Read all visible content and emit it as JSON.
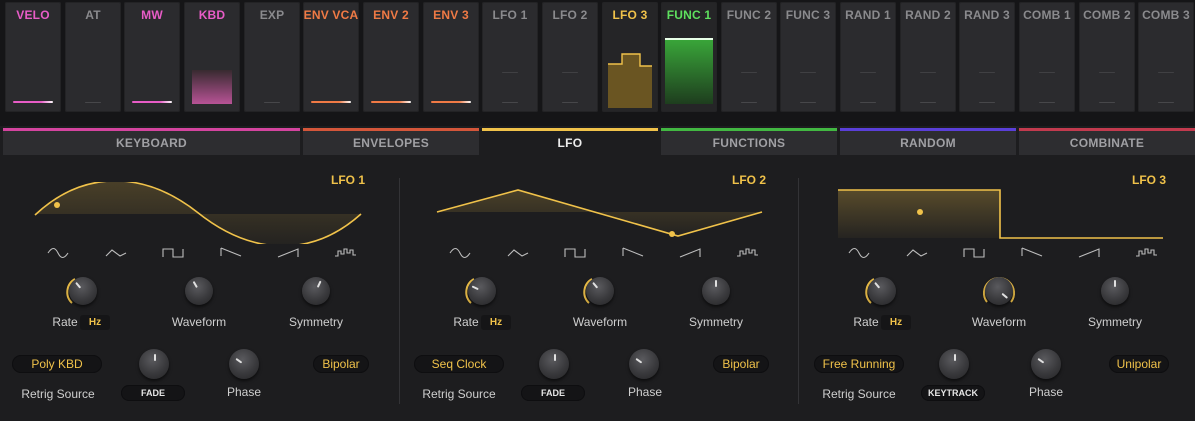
{
  "sources": [
    {
      "label": "VELO",
      "color": "#e85cc7",
      "bar": "#e85cc7"
    },
    {
      "label": "AT",
      "color": "#8a8a8d",
      "bar": ""
    },
    {
      "label": "MW",
      "color": "#e85cc7",
      "bar": "#e85cc7"
    },
    {
      "label": "KBD",
      "color": "#e85cc7",
      "bar": ""
    },
    {
      "label": "EXP",
      "color": "#8a8a8d",
      "bar": ""
    },
    {
      "label": "ENV VCA",
      "color": "#f07a45",
      "bar": "#f07a45"
    },
    {
      "label": "ENV 2",
      "color": "#f07a45",
      "bar": "#f07a45"
    },
    {
      "label": "ENV 3",
      "color": "#f07a45",
      "bar": "#f07a45"
    },
    {
      "label": "LFO 1",
      "color": "#8a8a8d",
      "bar": ""
    },
    {
      "label": "LFO 2",
      "color": "#8a8a8d",
      "bar": ""
    },
    {
      "label": "LFO 3",
      "color": "#f0c24a",
      "bar": ""
    },
    {
      "label": "FUNC 1",
      "color": "#5ee05e",
      "bar": ""
    },
    {
      "label": "FUNC 2",
      "color": "#8a8a8d",
      "bar": ""
    },
    {
      "label": "FUNC 3",
      "color": "#8a8a8d",
      "bar": ""
    },
    {
      "label": "RAND 1",
      "color": "#8a8a8d",
      "bar": ""
    },
    {
      "label": "RAND 2",
      "color": "#8a8a8d",
      "bar": ""
    },
    {
      "label": "RAND 3",
      "color": "#8a8a8d",
      "bar": ""
    },
    {
      "label": "COMB 1",
      "color": "#8a8a8d",
      "bar": ""
    },
    {
      "label": "COMB 2",
      "color": "#8a8a8d",
      "bar": ""
    },
    {
      "label": "COMB 3",
      "color": "#8a8a8d",
      "bar": ""
    }
  ],
  "categories": [
    {
      "label": "KEYBOARD",
      "color": "#d4449f"
    },
    {
      "label": "ENVELOPES",
      "color": "#d4563a"
    },
    {
      "label": "LFO",
      "color": "#f0c24a"
    },
    {
      "label": "FUNCTIONS",
      "color": "#42b842"
    },
    {
      "label": "RANDOM",
      "color": "#5a3fd8"
    },
    {
      "label": "COMBINATE",
      "color": "#c23a4e"
    }
  ],
  "accent": "#f0c24a",
  "lfos": [
    {
      "title": "LFO 1",
      "rate_label": "Rate",
      "rate_unit": "Hz",
      "waveform_label": "Waveform",
      "symmetry_label": "Symmetry",
      "retrig_value": "Poly KBD",
      "retrig_label": "Retrig Source",
      "mode_button": "FADE",
      "phase_label": "Phase",
      "polarity": "Bipolar",
      "shape": "sine"
    },
    {
      "title": "LFO 2",
      "rate_label": "Rate",
      "rate_unit": "Hz",
      "waveform_label": "Waveform",
      "symmetry_label": "Symmetry",
      "retrig_value": "Seq Clock",
      "retrig_label": "Retrig Source",
      "mode_button": "FADE",
      "phase_label": "Phase",
      "polarity": "Bipolar",
      "shape": "triangle"
    },
    {
      "title": "LFO 3",
      "rate_label": "Rate",
      "rate_unit": "Hz",
      "waveform_label": "Waveform",
      "symmetry_label": "Symmetry",
      "retrig_value": "Free Running",
      "retrig_label": "Retrig Source",
      "mode_button": "KEYTRACK",
      "phase_label": "Phase",
      "polarity": "Unipolar",
      "shape": "square"
    }
  ],
  "shape_icons": [
    "sine-icon",
    "triangle-icon",
    "square-icon",
    "ramp-down-icon",
    "ramp-up-icon",
    "random-icon"
  ]
}
